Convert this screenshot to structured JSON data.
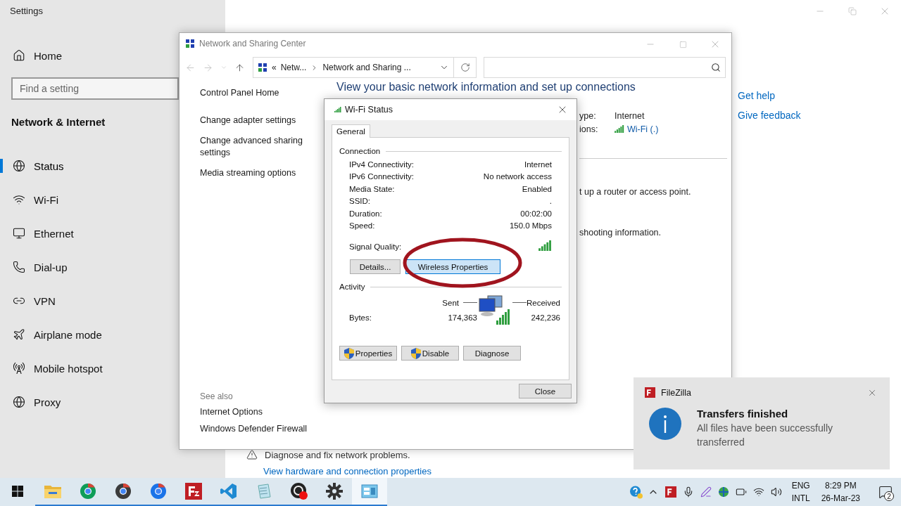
{
  "settings": {
    "title": "Settings",
    "home": "Home",
    "search": {
      "placeholder": "Find a setting"
    },
    "section": "Network & Internet",
    "nav": [
      {
        "label": "Status",
        "kind": "status",
        "selected": true
      },
      {
        "label": "Wi-Fi",
        "kind": "wifi",
        "selected": false
      },
      {
        "label": "Ethernet",
        "kind": "ethernet",
        "selected": false
      },
      {
        "label": "Dial-up",
        "kind": "dialup",
        "selected": false
      },
      {
        "label": "VPN",
        "kind": "vpn",
        "selected": false
      },
      {
        "label": "Airplane mode",
        "kind": "airplane",
        "selected": false
      },
      {
        "label": "Mobile hotspot",
        "kind": "hotspot",
        "selected": false
      },
      {
        "label": "Proxy",
        "kind": "proxy",
        "selected": false
      }
    ],
    "help_links": [
      "Get help",
      "Give feedback"
    ],
    "troubleshoot": "Diagnose and fix network problems.",
    "hardware_link": "View hardware and connection properties"
  },
  "network_center": {
    "title": "Network and Sharing Center",
    "address": {
      "overflow": "«",
      "crumbs": [
        "Netw...",
        "Network and Sharing ..."
      ]
    },
    "left_links": [
      "Control Panel Home",
      "Change adapter settings",
      "Change advanced sharing settings",
      "Media streaming options"
    ],
    "see_also": "See also",
    "see_also_links": [
      "Internet Options",
      "Windows Defender Firewall"
    ],
    "heading": "View your basic network information and set up connections",
    "partial": {
      "type_label": "ype:",
      "type_value": "Internet",
      "conn_label": "ions:",
      "conn_link": "Wi-Fi (.)",
      "router_text": "t up a router or access point.",
      "troubleshoot_text": "shooting information."
    }
  },
  "wifi_status": {
    "title": "Wi-Fi Status",
    "tabs": [
      {
        "label": "General",
        "selected": true
      }
    ],
    "connection": {
      "heading": "Connection",
      "rows": [
        {
          "label": "IPv4 Connectivity:",
          "value": "Internet"
        },
        {
          "label": "IPv6 Connectivity:",
          "value": "No network access"
        },
        {
          "label": "Media State:",
          "value": "Enabled"
        },
        {
          "label": "SSID:",
          "value": "."
        },
        {
          "label": "Duration:",
          "value": "00:02:00"
        },
        {
          "label": "Speed:",
          "value": "150.0 Mbps"
        }
      ]
    },
    "signal_label": "Signal Quality:",
    "actions": [
      {
        "label": "Details...",
        "focused": false
      },
      {
        "label": "Wireless Properties",
        "focused": true
      }
    ],
    "activity": {
      "heading": "Activity",
      "sent": "Sent",
      "received": "Received",
      "bytes_label": "Bytes:",
      "bytes_sent": "174,363",
      "bytes_received": "242,236"
    },
    "buttons": [
      {
        "label": "Properties",
        "kind": "shield"
      },
      {
        "label": "Disable",
        "kind": "shield"
      },
      {
        "label": "Diagnose",
        "kind": "plain"
      }
    ],
    "close": "Close"
  },
  "notification": {
    "app": "FileZilla",
    "title": "Transfers finished",
    "body": "All files have been successfully transferred"
  },
  "taskbar": {
    "apps": [
      {
        "kind": "explorer",
        "running": true,
        "selected": false
      },
      {
        "kind": "chrome",
        "running": true,
        "selected": false
      },
      {
        "kind": "chrome_dev",
        "running": true,
        "selected": false
      },
      {
        "kind": "chrome_beta",
        "running": true,
        "selected": false
      },
      {
        "kind": "filezilla",
        "running": true,
        "selected": false
      },
      {
        "kind": "vscode",
        "running": true,
        "selected": false
      },
      {
        "kind": "notepad",
        "running": true,
        "selected": false
      },
      {
        "kind": "obs",
        "running": true,
        "selected": false
      },
      {
        "kind": "settings",
        "running": true,
        "selected": false
      },
      {
        "kind": "control_panel",
        "running": true,
        "selected": true
      }
    ],
    "language": [
      "ENG",
      "INTL"
    ],
    "time": "8:29 PM",
    "date": "26-Mar-23",
    "notifications": "2"
  }
}
